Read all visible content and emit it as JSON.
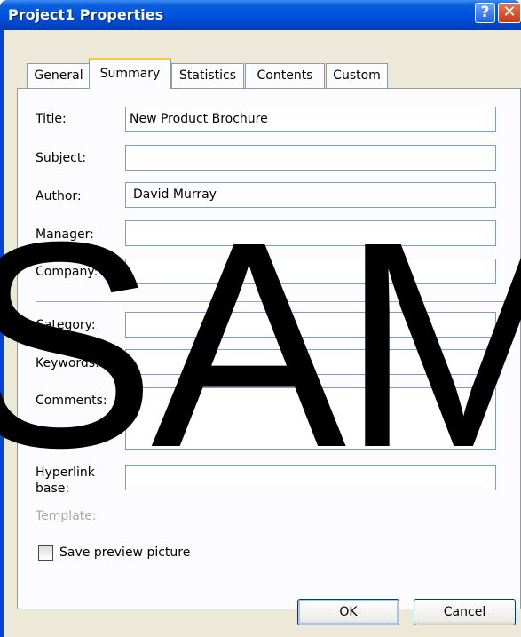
{
  "window": {
    "title": "Project1 Properties",
    "help_icon": "?",
    "close_icon": "✕"
  },
  "tabs": [
    {
      "label": "General",
      "active": false
    },
    {
      "label": "Summary",
      "active": true
    },
    {
      "label": "Statistics",
      "active": false
    },
    {
      "label": "Contents",
      "active": false
    },
    {
      "label": "Custom",
      "active": false
    }
  ],
  "fields": {
    "title": {
      "label": "Title:",
      "value": "New Product Brochure"
    },
    "subject": {
      "label": "Subject:",
      "value": ""
    },
    "author": {
      "label": "Author:",
      "value": "David Murray"
    },
    "manager": {
      "label": "Manager:",
      "value": ""
    },
    "company": {
      "label": "Company:",
      "value": ""
    },
    "category": {
      "label": "Category:",
      "value": ""
    },
    "keywords": {
      "label": "Keywords:",
      "value": ""
    },
    "comments": {
      "label": "Comments:",
      "value": ""
    },
    "hyperlink": {
      "label_line1": "Hyperlink",
      "label_line2": "base:",
      "value": ""
    },
    "template": {
      "label": "Template:"
    }
  },
  "save_preview": {
    "label": "Save preview picture",
    "checked": false
  },
  "buttons": {
    "ok": "OK",
    "cancel": "Cancel"
  },
  "watermark": "SAM",
  "colors": {
    "titlebar": "#0054e3",
    "dialog_bg": "#ece9d8",
    "active_tab_accent": "#ffc83c",
    "field_border": "#7f9db9",
    "disabled_text": "#aca899"
  }
}
